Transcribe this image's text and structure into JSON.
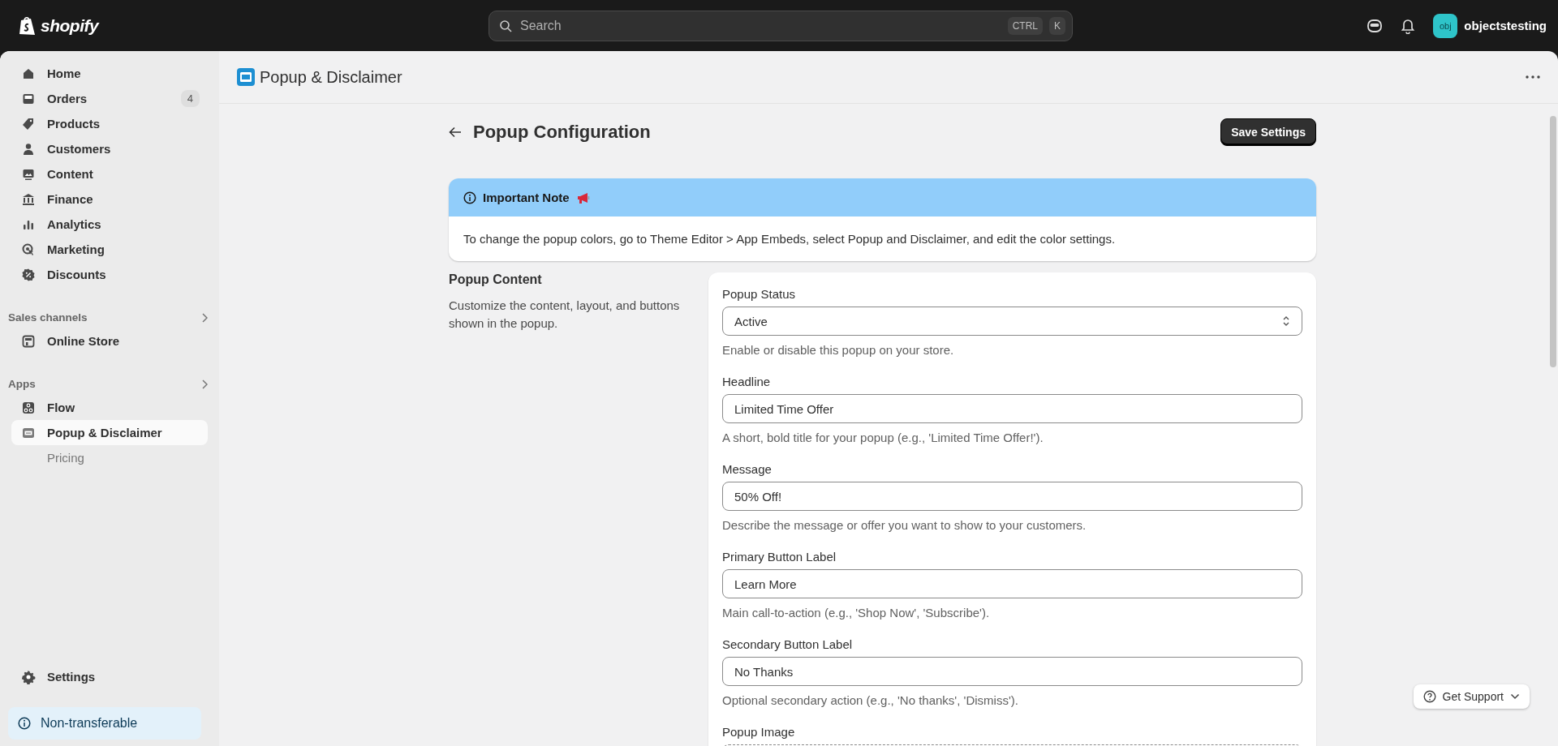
{
  "topbar": {
    "brand": "shopify",
    "search": {
      "placeholder": "Search",
      "shortcut": [
        "CTRL",
        "K"
      ]
    },
    "account": {
      "avatar": "obj",
      "name": "objectstesting"
    }
  },
  "sidebar": {
    "items": [
      {
        "label": "Home",
        "selected": false
      },
      {
        "label": "Orders",
        "selected": false,
        "badge": "4"
      },
      {
        "label": "Products",
        "selected": false
      },
      {
        "label": "Customers",
        "selected": false
      },
      {
        "label": "Content",
        "selected": false
      },
      {
        "label": "Finance",
        "selected": false
      },
      {
        "label": "Analytics",
        "selected": false
      },
      {
        "label": "Marketing",
        "selected": false
      },
      {
        "label": "Discounts",
        "selected": false
      }
    ],
    "sections": [
      {
        "title": "Sales channels",
        "items": [
          {
            "label": "Online Store",
            "selected": false
          }
        ]
      },
      {
        "title": "Apps",
        "items": [
          {
            "label": "Flow",
            "selected": false
          },
          {
            "label": "Popup & Disclaimer",
            "selected": true,
            "children": [
              {
                "label": "Pricing",
                "selected": false
              }
            ]
          }
        ]
      }
    ],
    "footer_items": [
      {
        "label": "Settings",
        "selected": false
      }
    ],
    "notice": "Non-transferable"
  },
  "app_header": {
    "title": "Popup & Disclaimer"
  },
  "page": {
    "title": "Popup Configuration",
    "primary_action": "Save Settings"
  },
  "note": {
    "title": "Important Note",
    "body": "To change the popup colors, go to Theme Editor > App Embeds, select Popup and Disclaimer, and edit the color settings."
  },
  "section": {
    "title": "Popup Content",
    "description": "Customize the content, layout, and buttons shown in the popup.",
    "fields": [
      {
        "kind": "select",
        "label": "Popup Status",
        "value": "Active",
        "help": "Enable or disable this popup on your store."
      },
      {
        "kind": "text",
        "label": "Headline",
        "value": "Limited Time Offer",
        "help": "A short, bold title for your popup (e.g., 'Limited Time Offer!')."
      },
      {
        "kind": "text",
        "label": "Message",
        "value": "50% Off!",
        "help": "Describe the message or offer you want to show to your customers."
      },
      {
        "kind": "text",
        "label": "Primary Button Label",
        "value": "Learn More",
        "help": "Main call-to-action (e.g., 'Shop Now', 'Subscribe')."
      },
      {
        "kind": "text",
        "label": "Secondary Button Label",
        "value": "No Thanks",
        "help": "Optional secondary action (e.g., 'No thanks', 'Dismiss')."
      },
      {
        "kind": "upload",
        "label": "Popup Image"
      }
    ]
  },
  "support_button": {
    "label": "Get Support"
  }
}
